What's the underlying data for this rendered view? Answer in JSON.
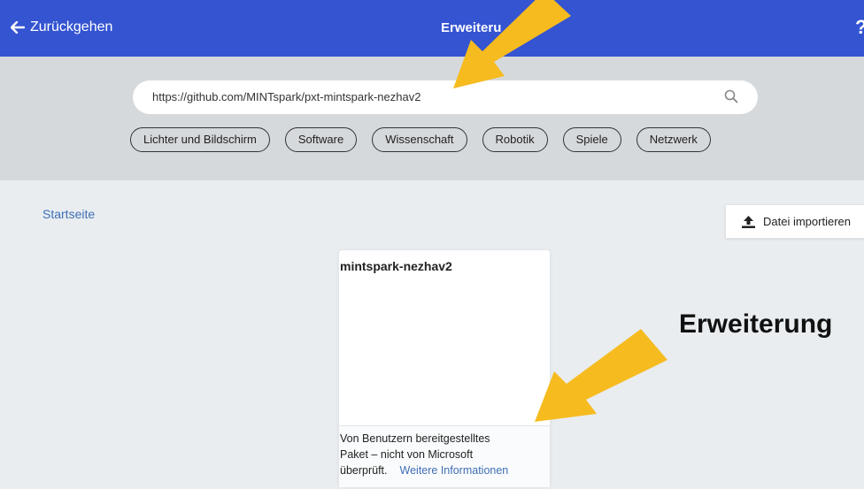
{
  "header": {
    "back_label": "Zurückgehen",
    "title": "Erweiteru",
    "help": "?"
  },
  "search": {
    "value": "https://github.com/MINTspark/pxt-mintspark-nezhav2"
  },
  "categories": [
    "Lichter und Bildschirm",
    "Software",
    "Wissenschaft",
    "Robotik",
    "Spiele",
    "Netzwerk"
  ],
  "main": {
    "home_link": "Startseite",
    "import_label": "Datei importieren"
  },
  "card": {
    "title": "mintspark-nezhav2",
    "footer_line1": "Von Benutzern bereitgestelltes",
    "footer_line2": "Paket – nicht von Microsoft",
    "footer_line3": "überprüft.",
    "more_link": "Weitere Informationen"
  },
  "annotation": {
    "text": "Erweiterung"
  },
  "colors": {
    "header": "#3454d1",
    "arrow": "#f6bb1f",
    "link": "#3f6fb5"
  }
}
